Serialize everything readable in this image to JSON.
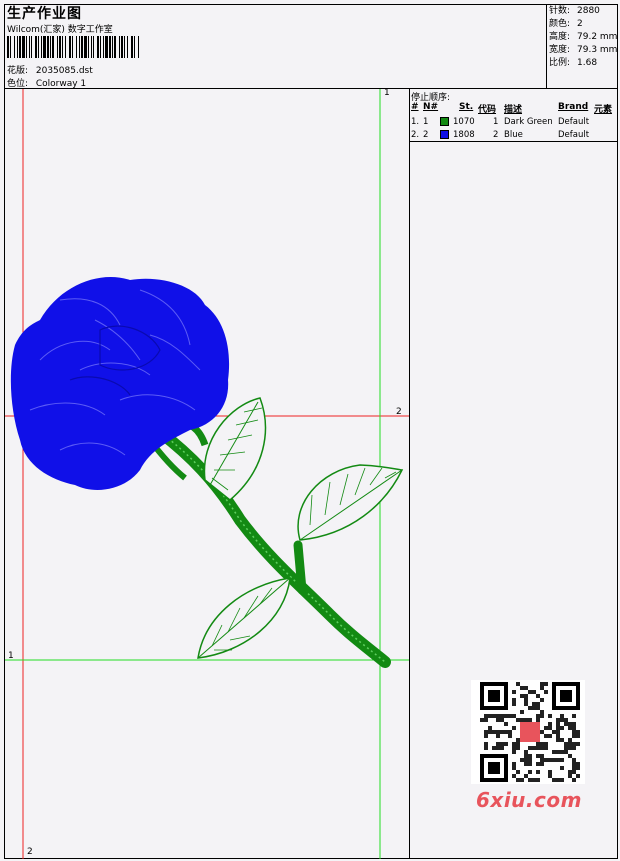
{
  "header": {
    "title": "生产作业图",
    "company": "Wilcom(汇家) 数字工作室",
    "design_label": "花版:",
    "design_value": "2035085.dst",
    "colorway_label": "色位:",
    "colorway_value": "Colorway 1"
  },
  "stats": [
    {
      "label": "针数:",
      "value": "2880"
    },
    {
      "label": "颜色:",
      "value": "2"
    },
    {
      "label": "高度:",
      "value": "79.2 mm"
    },
    {
      "label": "宽度:",
      "value": "79.3 mm"
    },
    {
      "label": "比例:",
      "value": "1.68"
    }
  ],
  "stop_sequence": {
    "title": "停止顺序:",
    "headers": {
      "num": "#",
      "no": "N#",
      "st": "St.",
      "code": "代码",
      "desc": "描述",
      "brand": "Brand",
      "elem": "元素"
    },
    "rows": [
      {
        "num": "1.",
        "no": "1",
        "color": "#138a13",
        "st": "1070",
        "code": "1",
        "desc": "Dark Green",
        "brand": "Default"
      },
      {
        "num": "2.",
        "no": "2",
        "color": "#1010e8",
        "st": "1808",
        "code": "2",
        "desc": "Blue",
        "brand": "Default"
      }
    ]
  },
  "axis_labels": {
    "top_right": "1",
    "mid_right": "2",
    "left_low": "1",
    "bottom_left": "2"
  },
  "watermark": {
    "site": "6xiu.com"
  },
  "colors": {
    "green_guide": "#22dd22",
    "red_guide": "#ee2222",
    "thread_green": "#138a13",
    "thread_blue": "#1010e8"
  }
}
